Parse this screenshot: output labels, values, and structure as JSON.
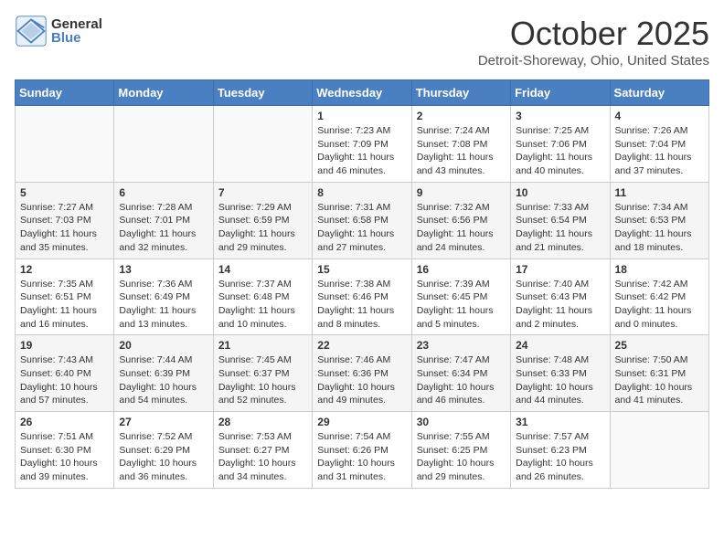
{
  "header": {
    "logo_general": "General",
    "logo_blue": "Blue",
    "month_title": "October 2025",
    "location": "Detroit-Shoreway, Ohio, United States"
  },
  "days_of_week": [
    "Sunday",
    "Monday",
    "Tuesday",
    "Wednesday",
    "Thursday",
    "Friday",
    "Saturday"
  ],
  "weeks": [
    [
      {
        "day": "",
        "info": ""
      },
      {
        "day": "",
        "info": ""
      },
      {
        "day": "",
        "info": ""
      },
      {
        "day": "1",
        "info": "Sunrise: 7:23 AM\nSunset: 7:09 PM\nDaylight: 11 hours and 46 minutes."
      },
      {
        "day": "2",
        "info": "Sunrise: 7:24 AM\nSunset: 7:08 PM\nDaylight: 11 hours and 43 minutes."
      },
      {
        "day": "3",
        "info": "Sunrise: 7:25 AM\nSunset: 7:06 PM\nDaylight: 11 hours and 40 minutes."
      },
      {
        "day": "4",
        "info": "Sunrise: 7:26 AM\nSunset: 7:04 PM\nDaylight: 11 hours and 37 minutes."
      }
    ],
    [
      {
        "day": "5",
        "info": "Sunrise: 7:27 AM\nSunset: 7:03 PM\nDaylight: 11 hours and 35 minutes."
      },
      {
        "day": "6",
        "info": "Sunrise: 7:28 AM\nSunset: 7:01 PM\nDaylight: 11 hours and 32 minutes."
      },
      {
        "day": "7",
        "info": "Sunrise: 7:29 AM\nSunset: 6:59 PM\nDaylight: 11 hours and 29 minutes."
      },
      {
        "day": "8",
        "info": "Sunrise: 7:31 AM\nSunset: 6:58 PM\nDaylight: 11 hours and 27 minutes."
      },
      {
        "day": "9",
        "info": "Sunrise: 7:32 AM\nSunset: 6:56 PM\nDaylight: 11 hours and 24 minutes."
      },
      {
        "day": "10",
        "info": "Sunrise: 7:33 AM\nSunset: 6:54 PM\nDaylight: 11 hours and 21 minutes."
      },
      {
        "day": "11",
        "info": "Sunrise: 7:34 AM\nSunset: 6:53 PM\nDaylight: 11 hours and 18 minutes."
      }
    ],
    [
      {
        "day": "12",
        "info": "Sunrise: 7:35 AM\nSunset: 6:51 PM\nDaylight: 11 hours and 16 minutes."
      },
      {
        "day": "13",
        "info": "Sunrise: 7:36 AM\nSunset: 6:49 PM\nDaylight: 11 hours and 13 minutes."
      },
      {
        "day": "14",
        "info": "Sunrise: 7:37 AM\nSunset: 6:48 PM\nDaylight: 11 hours and 10 minutes."
      },
      {
        "day": "15",
        "info": "Sunrise: 7:38 AM\nSunset: 6:46 PM\nDaylight: 11 hours and 8 minutes."
      },
      {
        "day": "16",
        "info": "Sunrise: 7:39 AM\nSunset: 6:45 PM\nDaylight: 11 hours and 5 minutes."
      },
      {
        "day": "17",
        "info": "Sunrise: 7:40 AM\nSunset: 6:43 PM\nDaylight: 11 hours and 2 minutes."
      },
      {
        "day": "18",
        "info": "Sunrise: 7:42 AM\nSunset: 6:42 PM\nDaylight: 11 hours and 0 minutes."
      }
    ],
    [
      {
        "day": "19",
        "info": "Sunrise: 7:43 AM\nSunset: 6:40 PM\nDaylight: 10 hours and 57 minutes."
      },
      {
        "day": "20",
        "info": "Sunrise: 7:44 AM\nSunset: 6:39 PM\nDaylight: 10 hours and 54 minutes."
      },
      {
        "day": "21",
        "info": "Sunrise: 7:45 AM\nSunset: 6:37 PM\nDaylight: 10 hours and 52 minutes."
      },
      {
        "day": "22",
        "info": "Sunrise: 7:46 AM\nSunset: 6:36 PM\nDaylight: 10 hours and 49 minutes."
      },
      {
        "day": "23",
        "info": "Sunrise: 7:47 AM\nSunset: 6:34 PM\nDaylight: 10 hours and 46 minutes."
      },
      {
        "day": "24",
        "info": "Sunrise: 7:48 AM\nSunset: 6:33 PM\nDaylight: 10 hours and 44 minutes."
      },
      {
        "day": "25",
        "info": "Sunrise: 7:50 AM\nSunset: 6:31 PM\nDaylight: 10 hours and 41 minutes."
      }
    ],
    [
      {
        "day": "26",
        "info": "Sunrise: 7:51 AM\nSunset: 6:30 PM\nDaylight: 10 hours and 39 minutes."
      },
      {
        "day": "27",
        "info": "Sunrise: 7:52 AM\nSunset: 6:29 PM\nDaylight: 10 hours and 36 minutes."
      },
      {
        "day": "28",
        "info": "Sunrise: 7:53 AM\nSunset: 6:27 PM\nDaylight: 10 hours and 34 minutes."
      },
      {
        "day": "29",
        "info": "Sunrise: 7:54 AM\nSunset: 6:26 PM\nDaylight: 10 hours and 31 minutes."
      },
      {
        "day": "30",
        "info": "Sunrise: 7:55 AM\nSunset: 6:25 PM\nDaylight: 10 hours and 29 minutes."
      },
      {
        "day": "31",
        "info": "Sunrise: 7:57 AM\nSunset: 6:23 PM\nDaylight: 10 hours and 26 minutes."
      },
      {
        "day": "",
        "info": ""
      }
    ]
  ]
}
